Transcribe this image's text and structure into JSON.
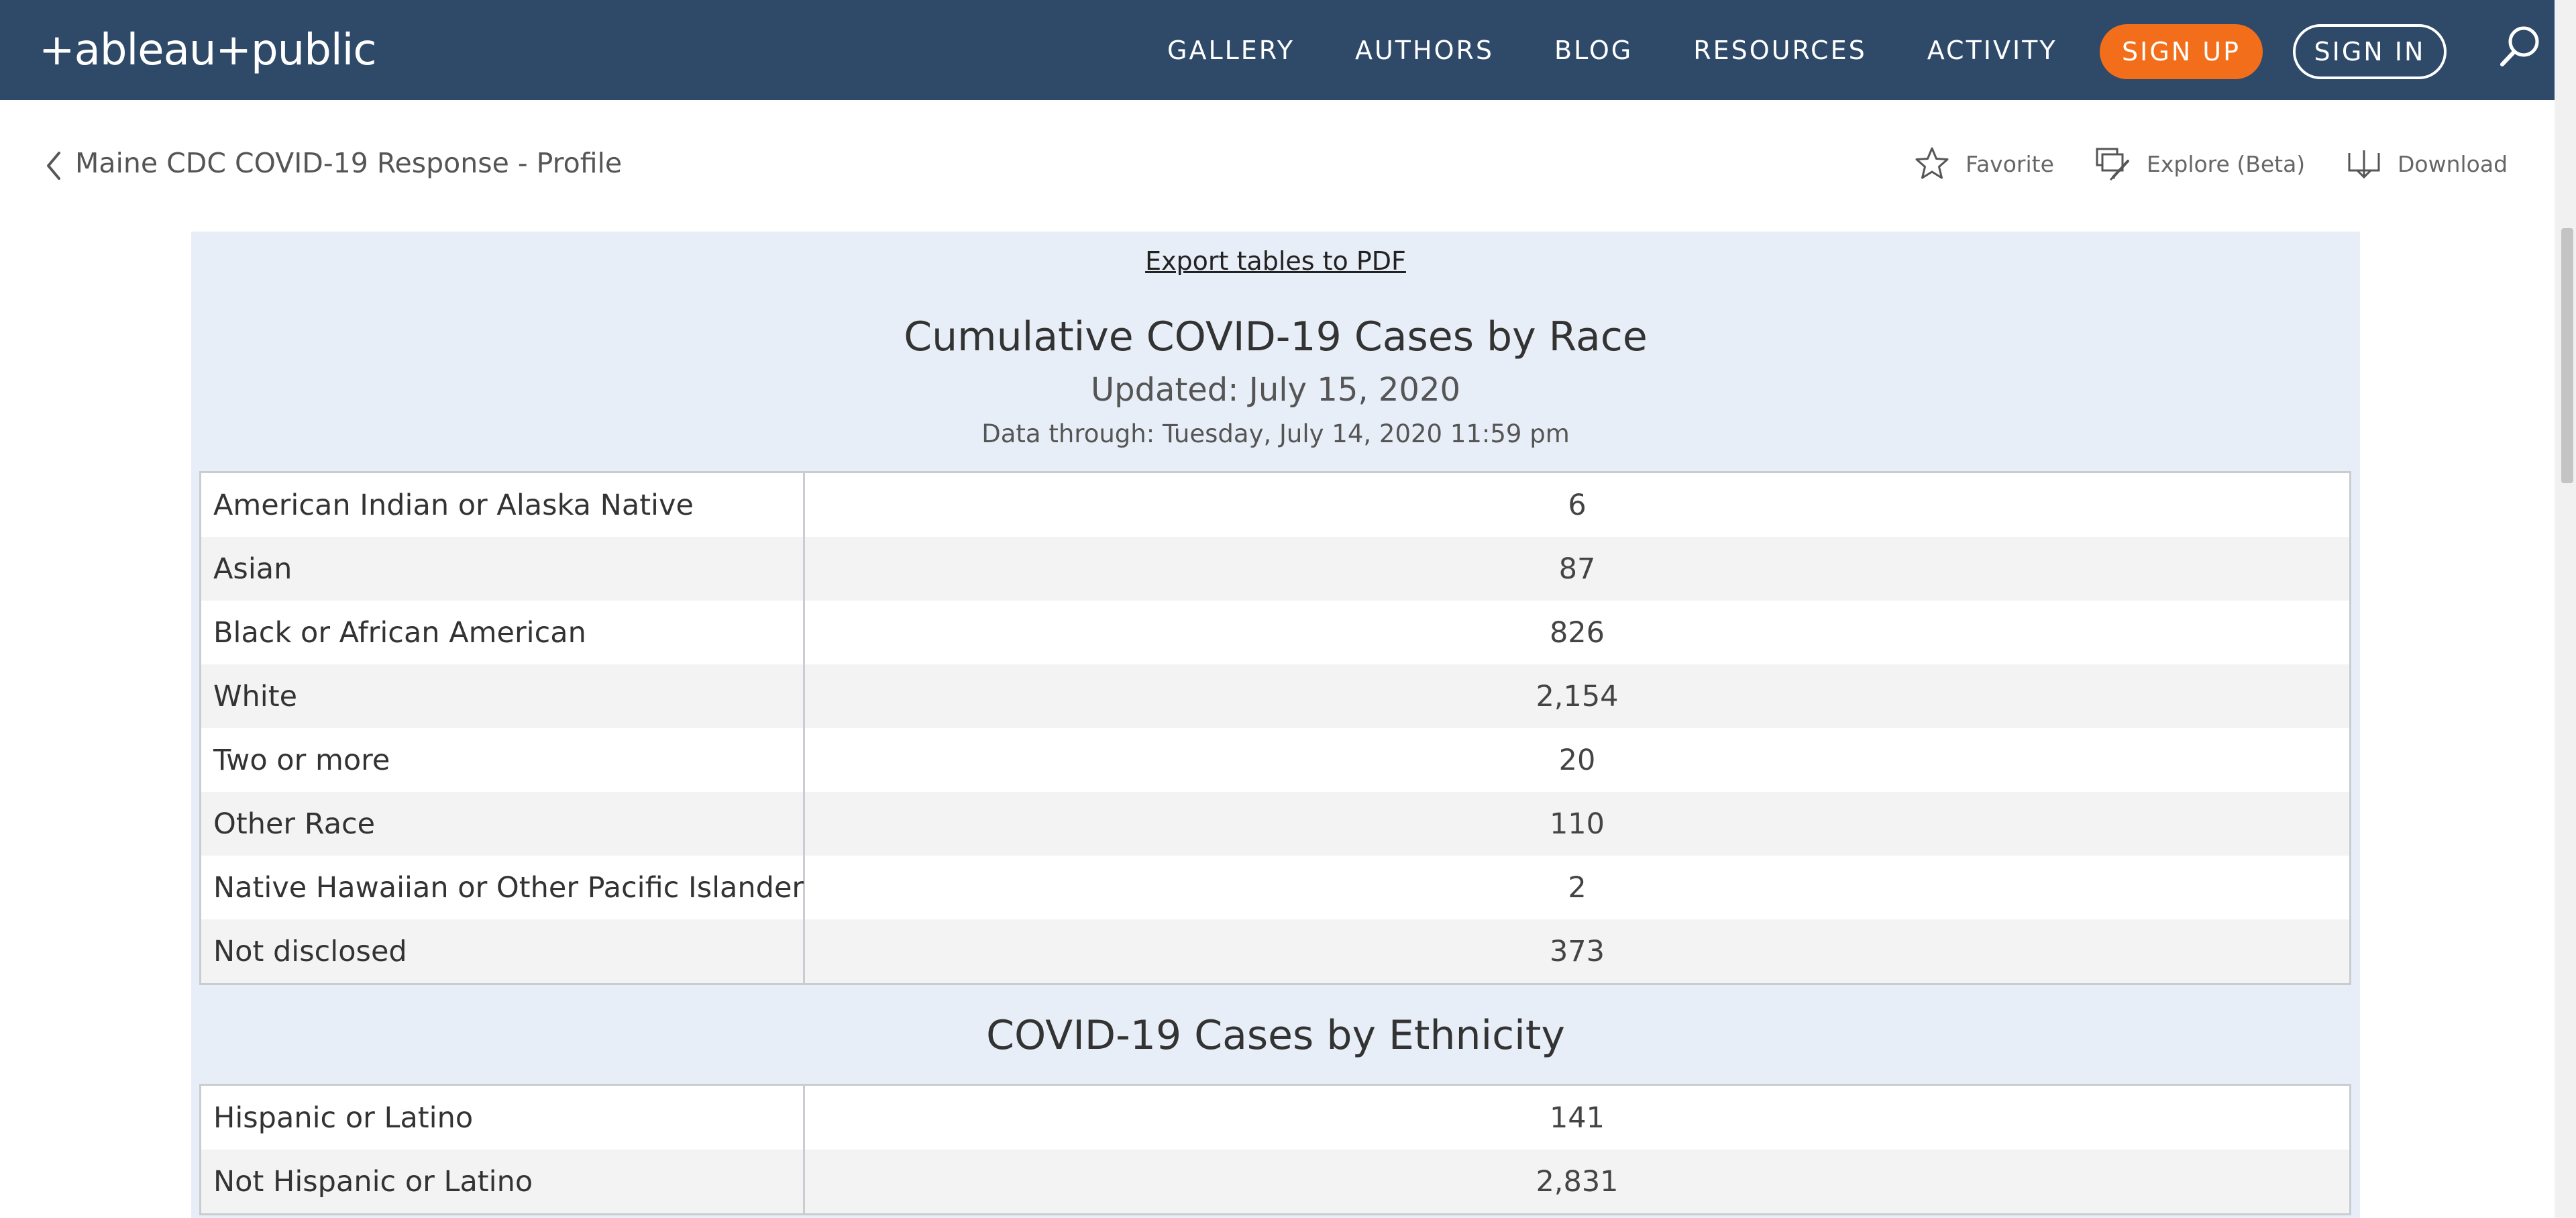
{
  "header": {
    "logo_text": "+ableau+public",
    "nav": [
      "GALLERY",
      "AUTHORS",
      "BLOG",
      "RESOURCES",
      "ACTIVITY"
    ],
    "signup_label": "SIGN UP",
    "signin_label": "SIGN IN",
    "search_icon": "search-icon",
    "bg_color": "#2e4a68",
    "signup_color": "#f26e1b"
  },
  "breadcrumb": {
    "title": "Maine CDC COVID-19 Response - Profile",
    "back_icon": "chevron-left-icon"
  },
  "actions": {
    "favorite_label": "Favorite",
    "explore_label": "Explore (Beta)",
    "download_label": "Download"
  },
  "dashboard": {
    "export_label": "Export tables to PDF",
    "race": {
      "title": "Cumulative COVID-19 Cases by Race",
      "updated": "Updated: July 15, 2020",
      "data_through": "Data through: Tuesday, July 14, 2020 11:59 pm",
      "rows": [
        {
          "label": "American Indian or Alaska Native",
          "value": "6"
        },
        {
          "label": "Asian",
          "value": "87"
        },
        {
          "label": "Black or African American",
          "value": "826"
        },
        {
          "label": "White",
          "value": "2,154"
        },
        {
          "label": "Two or more",
          "value": "20"
        },
        {
          "label": "Other Race",
          "value": "110"
        },
        {
          "label": "Native Hawaiian or Other Pacific Islander",
          "value": "2"
        },
        {
          "label": "Not disclosed",
          "value": "373"
        }
      ]
    },
    "ethnicity": {
      "title": "COVID-19 Cases by Ethnicity",
      "rows": [
        {
          "label": "Hispanic or Latino",
          "value": "141"
        },
        {
          "label": "Not Hispanic or Latino",
          "value": "2,831"
        }
      ]
    },
    "panel_color": "#e8eef7"
  }
}
